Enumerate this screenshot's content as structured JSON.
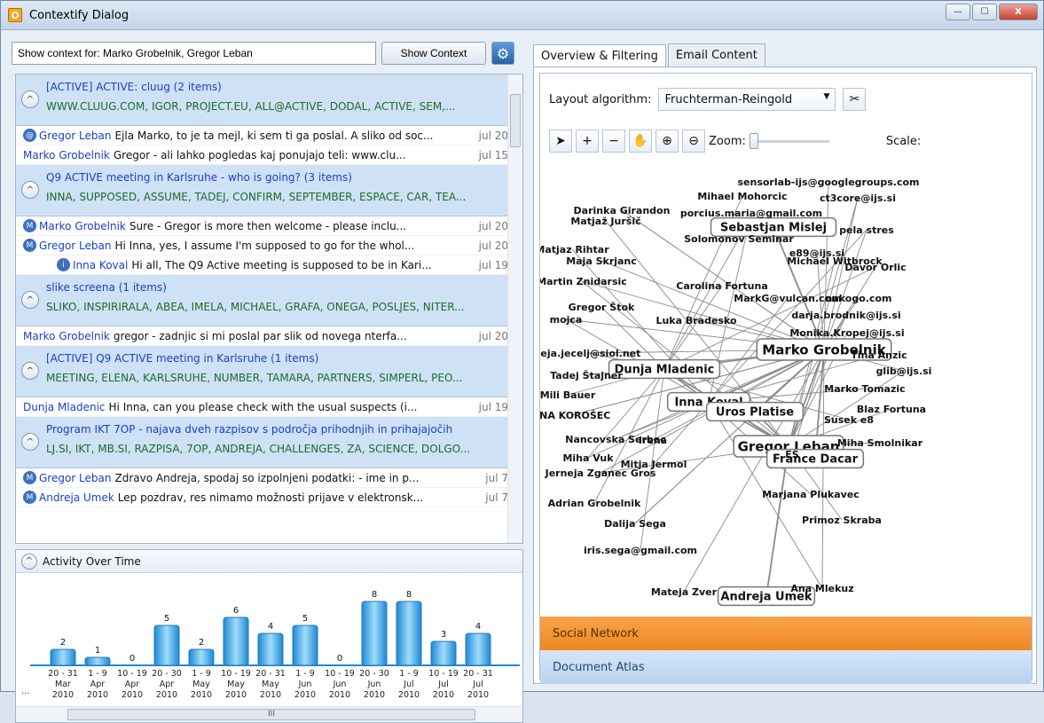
{
  "window": {
    "app_icon": "O",
    "title": "Contextify Dialog",
    "min_glyph": "—",
    "max_glyph": "☐",
    "close_glyph": "X"
  },
  "query": {
    "value": "Show context for: Marko Grobelnik, Gregor Leban",
    "button": "Show Context"
  },
  "groups": [
    {
      "title": "[ACTIVE] ACTIVE: cluug (2 items)",
      "keywords": "WWW.CLUUG.COM, IGOR, PROJECT.EU, ALL@ACTIVE, DODAL, ACTIVE, SEM,...",
      "messages": [
        {
          "icon": "@",
          "from": "Gregor Leban",
          "text": "Ejla Marko, to je ta mejl, ki sem ti ga poslal. A sliko od soc...",
          "date": "jul 20"
        },
        {
          "icon": "",
          "from": "Marko Grobelnik",
          "text": "Gregor - ali lahko pogledas kaj ponujajo teli: www.clu...",
          "date": "jul 15"
        }
      ]
    },
    {
      "title": "Q9 ACTIVE meeting in Karlsruhe - who is going? (3 items)",
      "keywords": "INNA, SUPPOSED, ASSUME, TADEJ, CONFIRM, SEPTEMBER, ESPACE, CAR, TEA...",
      "messages": [
        {
          "icon": "M",
          "from": "Marko Grobelnik",
          "text": "Sure - Gregor is more then welcome - please inclu...",
          "date": "jul 20"
        },
        {
          "icon": "M",
          "from": "Gregor Leban",
          "text": "Hi Inna, yes, I assume I'm supposed to go for the whol...",
          "date": "jul 20"
        },
        {
          "icon": "i",
          "from": "Inna Koval",
          "text": "Hi all, The Q9 Active meeting is supposed to be in Kari...",
          "date": "jul 19"
        }
      ]
    },
    {
      "title": "slike screena (1 items)",
      "keywords": "SLIKO, INSPIRIRALA, ABEA, IMELA, MICHAEL, GRAFA, ONEGA, POSLJES, NITER...",
      "messages": [
        {
          "icon": "",
          "from": "Marko Grobelnik",
          "text": "gregor - zadnjic si mi poslal par slik od novega nterfa...",
          "date": "jul 20"
        }
      ]
    },
    {
      "title": "[ACTIVE] Q9 ACTIVE meeting in Karlsruhe (1 items)",
      "keywords": "MEETING, ELENA, KARLSRUHE, NUMBER, TAMARA, PARTNERS, SIMPERL, PEO...",
      "messages": [
        {
          "icon": "",
          "from": "Dunja Mladenic",
          "text": "Hi Inna, can you please check with the usual suspects (i...",
          "date": "jul 19"
        }
      ]
    },
    {
      "title": "Program IKT 7OP - najava dveh razpisov s področja prihodnjih in prihajajočih",
      "keywords": "LJ.SI, IKT, MB.SI, RAZPISA, 7OP, ANDREJA, CHALLENGES, ZA, SCIENCE, DOLGO...",
      "messages": [
        {
          "icon": "M",
          "from": "Gregor Leban",
          "text": "Zdravo Andreja, spodaj so izpolnjeni podatki: - ime in p...",
          "date": "jul 7"
        },
        {
          "icon": "M",
          "from": "Andreja Umek",
          "text": "Lep pozdrav, res nimamo možnosti prijave v elektronsk...",
          "date": "jul 7"
        }
      ]
    }
  ],
  "activity": {
    "title": "Activity Over Time",
    "scroll_glyph": "III",
    "leading": "..."
  },
  "chart_data": {
    "type": "bar",
    "title": "Activity Over Time",
    "categories": [
      "20 - 31 Mar 2010",
      "1 - 9 Apr 2010",
      "10 - 19 Apr 2010",
      "20 - 30 Apr 2010",
      "1 - 9 May 2010",
      "10 - 19 May 2010",
      "20 - 31 May 2010",
      "1 - 9 Jun 2010",
      "10 - 19 Jun 2010",
      "20 - 30 Jun 2010",
      "1 - 9 Jul 2010",
      "10 - 19 Jul 2010",
      "20 - 31 Jul 2010"
    ],
    "cat_lines": [
      [
        "20 - 31",
        "Mar",
        "2010"
      ],
      [
        "1 - 9",
        "Apr",
        "2010"
      ],
      [
        "10 - 19",
        "Apr",
        "2010"
      ],
      [
        "20 - 30",
        "Apr",
        "2010"
      ],
      [
        "1 - 9",
        "May",
        "2010"
      ],
      [
        "10 - 19",
        "May",
        "2010"
      ],
      [
        "20 - 31",
        "May",
        "2010"
      ],
      [
        "1 - 9",
        "Jun",
        "2010"
      ],
      [
        "10 - 19",
        "Jun",
        "2010"
      ],
      [
        "20 - 30",
        "Jun",
        "2010"
      ],
      [
        "1 - 9",
        "Jul",
        "2010"
      ],
      [
        "10 - 19",
        "Jul",
        "2010"
      ],
      [
        "20 - 31",
        "Jul",
        "2010"
      ]
    ],
    "values": [
      2,
      1,
      0,
      5,
      2,
      6,
      4,
      5,
      0,
      8,
      8,
      3,
      4
    ]
  },
  "right": {
    "tabs": [
      "Overview & Filtering",
      "Email Content"
    ],
    "layout_label": "Layout algorithm:",
    "layout_value": "Fruchterman-Reingold",
    "zoom_label": "Zoom:",
    "scale_label": "Scale:",
    "sections": [
      "Social Network",
      "Document Atlas"
    ]
  },
  "network": {
    "nodes": [
      {
        "label": "Marko Grobelnik",
        "boxed": true,
        "big": true
      },
      {
        "label": "Gregor Leban",
        "boxed": true,
        "big": true
      },
      {
        "label": "Dunja Mladenic",
        "boxed": true,
        "big": false
      },
      {
        "label": "Inna Koval",
        "boxed": true,
        "big": false
      },
      {
        "label": "Uros Platise",
        "boxed": true,
        "big": false
      },
      {
        "label": "France Dacar",
        "boxed": true,
        "big": false
      },
      {
        "label": "Sebastjan Mislej",
        "boxed": true,
        "big": false
      },
      {
        "label": "Andreja Umek",
        "boxed": true,
        "big": false
      },
      {
        "label": "sensorlab-ijs@googlegroups.com"
      },
      {
        "label": "ct3core@ijs.si"
      },
      {
        "label": "Mihael Mohorcic"
      },
      {
        "label": "porcius.maria@gmail.com"
      },
      {
        "label": "Darinka Girandon"
      },
      {
        "label": "Matjaž Juršič"
      },
      {
        "label": "Solomonov Seminar"
      },
      {
        "label": "pela stres"
      },
      {
        "label": "e89@ijs.si"
      },
      {
        "label": "Michael Witbrock"
      },
      {
        "label": "Davor Orlic"
      },
      {
        "label": "Matjaz Rihtar"
      },
      {
        "label": "Maja Skrjanc"
      },
      {
        "label": "Martin Znidarsic"
      },
      {
        "label": "Carolina Fortuna"
      },
      {
        "label": "MarkG@vulcan.com"
      },
      {
        "label": "nakogo.com"
      },
      {
        "label": "darja.brodnik@ijs.si"
      },
      {
        "label": "Gregor Štok"
      },
      {
        "label": "mojca"
      },
      {
        "label": "Luka Bradesko"
      },
      {
        "label": "Monika.Kropej@ijs.si"
      },
      {
        "label": "leja.jecelj@siol.net"
      },
      {
        "label": "Tina Anzic"
      },
      {
        "label": "Tadej Štajner"
      },
      {
        "label": "glib@ijs.si"
      },
      {
        "label": "Mili Bauer"
      },
      {
        "label": "Marko Tomazic"
      },
      {
        "label": "ANA KOROŠEC"
      },
      {
        "label": "Blaz Fortuna"
      },
      {
        "label": "Susek e8"
      },
      {
        "label": "Nancovska Serbec"
      },
      {
        "label": "Irena"
      },
      {
        "label": "Miha Smolnikar"
      },
      {
        "label": "Miha Vuk"
      },
      {
        "label": "Mitja Jermol"
      },
      {
        "label": "ES"
      },
      {
        "label": "Jerneja Zganec Gros"
      },
      {
        "label": "Adrian Grobelnik"
      },
      {
        "label": "Marjana Plukavec"
      },
      {
        "label": "Dalija Sega"
      },
      {
        "label": "Primoz Skraba"
      },
      {
        "label": "iris.sega@gmail.com"
      },
      {
        "label": "Ana Mlekuz"
      },
      {
        "label": "Mateja Zver"
      }
    ]
  }
}
